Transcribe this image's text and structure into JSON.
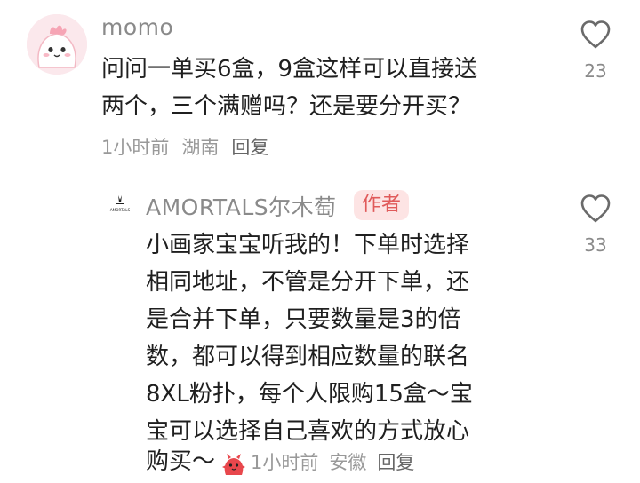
{
  "comment1": {
    "username": "momo",
    "text_line1": "问问一单买6盒，9盒这样可以直接送",
    "text_line2": "两个，三个满赠吗？还是要分开买？",
    "time": "1小时前",
    "location": "湖南",
    "reply": "回复",
    "likes": "23",
    "avatar_icon": "pink-blob-avatar-icon",
    "like_icon": "heart-outline-icon"
  },
  "comment2": {
    "username": "AMORTALS尔木萄",
    "author_badge": "作者",
    "logo_text": "AMORTALS",
    "text_lines": [
      "小画家宝宝听我的！下单时选择",
      "相同地址，不管是分开下单，还",
      "是合并下单，只要数量是3的倍",
      "数，都可以得到相应数量的联名",
      "8XL粉扑，每个人限购15盒～宝",
      "宝可以选择自己喜欢的方式放心"
    ],
    "last_line": "购买～",
    "time": "1小时前",
    "location": "安徽",
    "reply": "回复",
    "likes": "33",
    "sticker_icon": "red-creature-sticker-icon",
    "like_icon": "heart-outline-icon"
  },
  "colors": {
    "badge_bg": "#fde4e4",
    "badge_text": "#e05a5a",
    "avatar_bg": "#fbe8ec"
  }
}
